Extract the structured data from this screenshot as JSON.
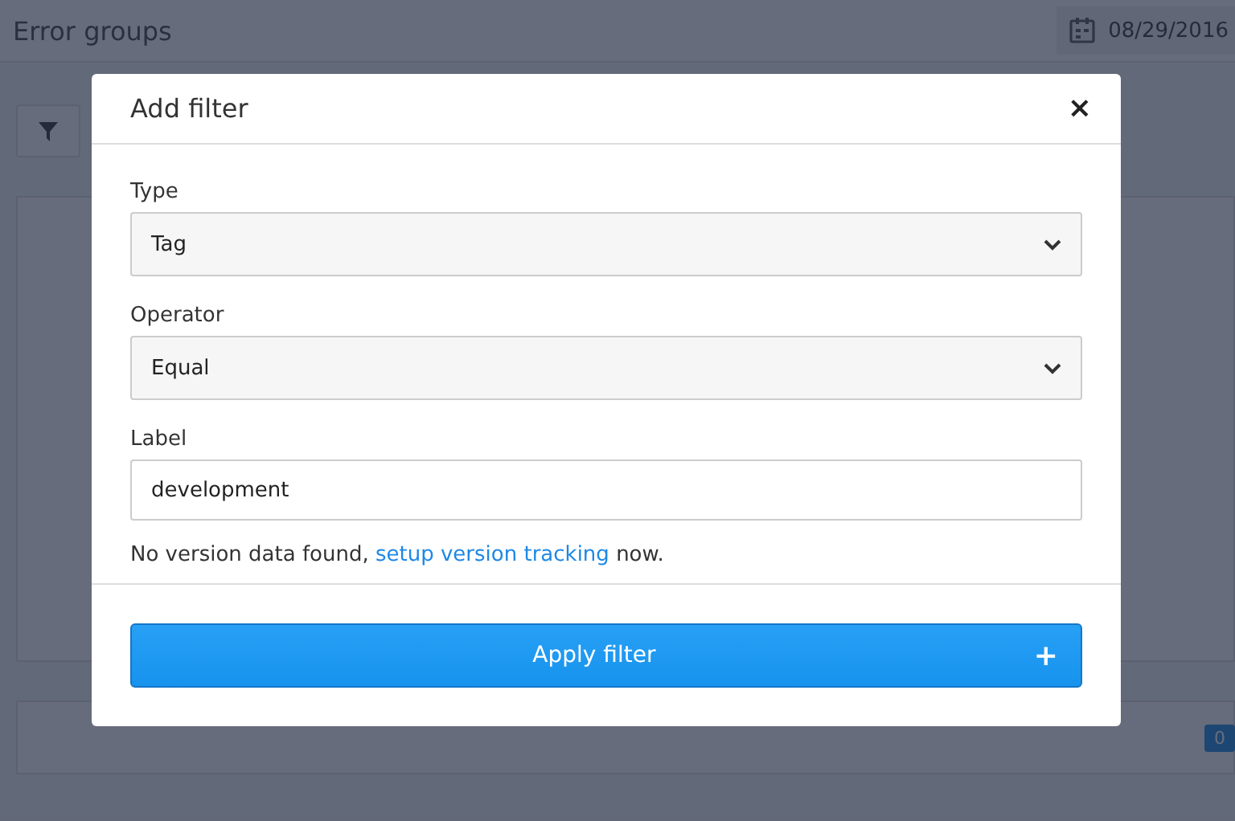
{
  "page": {
    "title": "Error groups",
    "date": "08/29/2016",
    "badge": "0"
  },
  "dialog": {
    "title": "Add filter",
    "close": "×",
    "fields": [
      {
        "kind": "select",
        "label": "Type",
        "value": "Tag"
      },
      {
        "kind": "select",
        "label": "Operator",
        "value": "Equal"
      },
      {
        "kind": "input",
        "label": "Label",
        "value": "development"
      }
    ],
    "note": {
      "text": "No version data found,",
      "link": "setup version tracking",
      "after": "now."
    },
    "button": {
      "label": "Apply filter",
      "icon": "+"
    }
  }
}
